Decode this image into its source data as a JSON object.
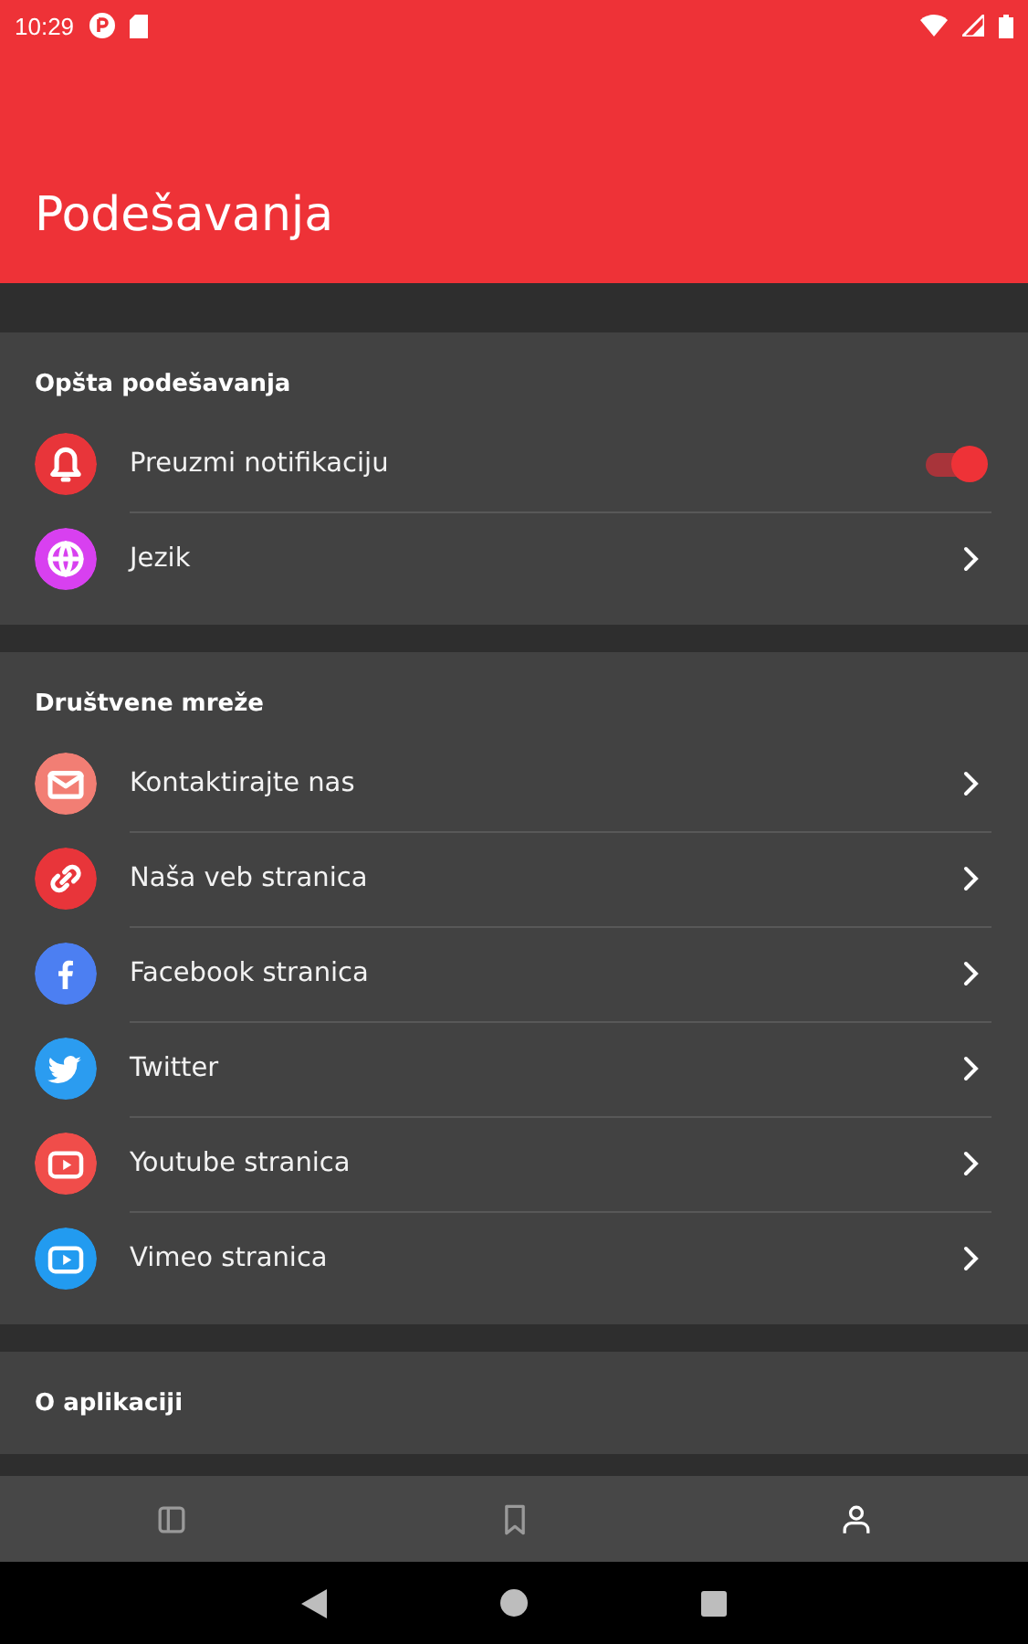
{
  "status_bar": {
    "time": "10:29"
  },
  "app_bar": {
    "title": "Podešavanja"
  },
  "sections": [
    {
      "heading": "Opšta podešavanja",
      "items": [
        {
          "label": "Preuzmi notifikaciju",
          "kind": "toggle",
          "on": true,
          "color": "#e8353a"
        },
        {
          "label": "Jezik",
          "kind": "link",
          "color": "#d840f0"
        }
      ]
    },
    {
      "heading": "Društvene mreže",
      "items": [
        {
          "label": "Kontaktirajte nas",
          "kind": "link",
          "color": "#f27e74"
        },
        {
          "label": "Naša veb stranica",
          "kind": "link",
          "color": "#e8353a"
        },
        {
          "label": "Facebook stranica",
          "kind": "link",
          "color": "#4c7ff2"
        },
        {
          "label": "Twitter",
          "kind": "link",
          "color": "#2b9cf0"
        },
        {
          "label": "Youtube stranica",
          "kind": "link",
          "color": "#f04d4a"
        },
        {
          "label": "Vimeo stranica",
          "kind": "link",
          "color": "#229bf0"
        }
      ]
    },
    {
      "heading": "O aplikaciji"
    }
  ],
  "bottom_nav": [
    {
      "selected": false
    },
    {
      "selected": false
    },
    {
      "selected": true
    }
  ]
}
